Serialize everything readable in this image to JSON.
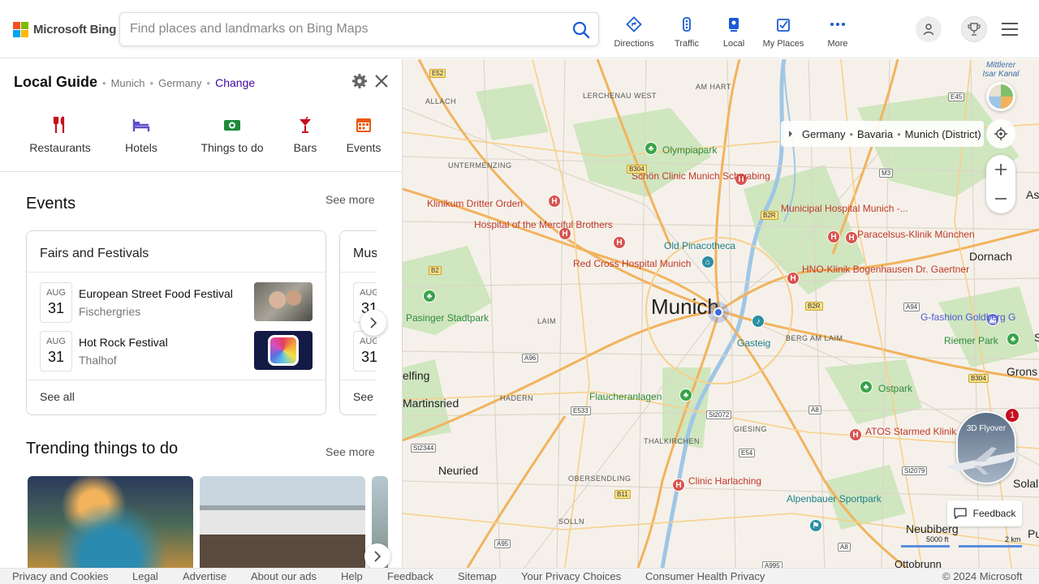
{
  "header": {
    "brand": "Microsoft Bing",
    "search_placeholder": "Find places and landmarks on Bing Maps",
    "nav": [
      {
        "label": "Directions",
        "icon": "directions-icon"
      },
      {
        "label": "Traffic",
        "icon": "traffic-icon"
      },
      {
        "label": "Local",
        "icon": "local-icon"
      },
      {
        "label": "My Places",
        "icon": "my-places-icon"
      },
      {
        "label": "More",
        "icon": "more-icon"
      }
    ],
    "accent": "#1a5bd6"
  },
  "panel": {
    "title": "Local Guide",
    "location": [
      "Munich",
      "Germany"
    ],
    "change_label": "Change",
    "categories": [
      {
        "label": "Restaurants",
        "color": "#c50f1f"
      },
      {
        "label": "Hotels",
        "color": "#5b4fc9"
      },
      {
        "label": "Things to do",
        "color": "#1f8a3a"
      },
      {
        "label": "Bars",
        "color": "#c50f1f"
      },
      {
        "label": "Events",
        "color": "#e8590c"
      }
    ],
    "events": {
      "title": "Events",
      "see_more": "See more",
      "cards": [
        {
          "title": "Fairs and Festivals",
          "items": [
            {
              "month": "AUG",
              "day": "31",
              "name": "European Street Food Festival",
              "venue": "Fischergries"
            },
            {
              "month": "AUG",
              "day": "31",
              "name": "Hot Rock Festival",
              "venue": "Thalhof"
            }
          ],
          "see_all": "See all"
        },
        {
          "title": "Mus",
          "items": [
            {
              "month": "AUG",
              "day": "31"
            },
            {
              "month": "AUG",
              "day": "31"
            }
          ],
          "see_all": "See"
        }
      ]
    },
    "trending": {
      "title": "Trending things to do",
      "see_more": "See more"
    }
  },
  "map": {
    "breadcrumb": [
      "Germany",
      "Bavaria",
      "Munich (District)"
    ],
    "city_label": "Munich",
    "flyover_label": "3D Flyover",
    "flyover_badge": "1",
    "feedback_label": "Feedback",
    "scale_ft": "5000 ft",
    "scale_km": "2 km",
    "districts": [
      "ALLACH",
      "LERCHENAU WEST",
      "AM HART",
      "UNTERMENZING",
      "LAIM",
      "HADERN",
      "THALKIRCHEN",
      "GIESING",
      "OBERSENDLING",
      "SOLLN",
      "BERG AM LAIM"
    ],
    "places": {
      "olympiapark": "Olympiapark",
      "schoen": "Schön Clinic Munich Schwabing",
      "klinikum": "Klinikum Dritter Orden",
      "merciful": "Hospital of the Merciful Brothers",
      "redcross": "Red Cross Hospital Munich",
      "pinacotheca": "Old Pinacotheca",
      "municipal": "Municipal Hospital Munich -...",
      "paracelsus": "Paracelsus-Klinik München",
      "hno": "HNO-Klinik Bogenhausen Dr. Gaertner",
      "pasing": "Pasinger Stadtpark",
      "gasteig": "Gasteig",
      "gfashion": "G-fashion Goldberg G",
      "riemer": "Riemer Park",
      "ostpark": "Ostpark",
      "flaucher": "Flaucheranlagen",
      "atos": "ATOS Starmed Klinik München",
      "harlaching": "Clinic Harlaching",
      "alpenbauer": "Alpenbauer Sportpark",
      "dornach": "Dornach",
      "gronsdorf": "Grons",
      "neuried": "Neuried",
      "martinsried": "Martinsried",
      "elfing": "elfing",
      "neubiberg": "Neubiberg",
      "solalinden": "Solalin",
      "ottobrunn": "Ottobrunn",
      "as": "As",
      "sa": "Sa",
      "put": "Put",
      "mittlerer": "Mittlerer Isar Kanal"
    },
    "roads": [
      "E52",
      "B304",
      "M3",
      "B2R",
      "E45",
      "B2",
      "A94",
      "A96",
      "E533",
      "St2072",
      "A8",
      "E54",
      "St2344",
      "B11",
      "A95",
      "A995",
      "St2079",
      "B304",
      "A8",
      "B2R"
    ]
  },
  "footer": {
    "links": [
      "Privacy and Cookies",
      "Legal",
      "Advertise",
      "About our ads",
      "Help",
      "Feedback",
      "Sitemap",
      "Your Privacy Choices",
      "Consumer Health Privacy"
    ],
    "copyright": "© 2024 Microsoft"
  }
}
